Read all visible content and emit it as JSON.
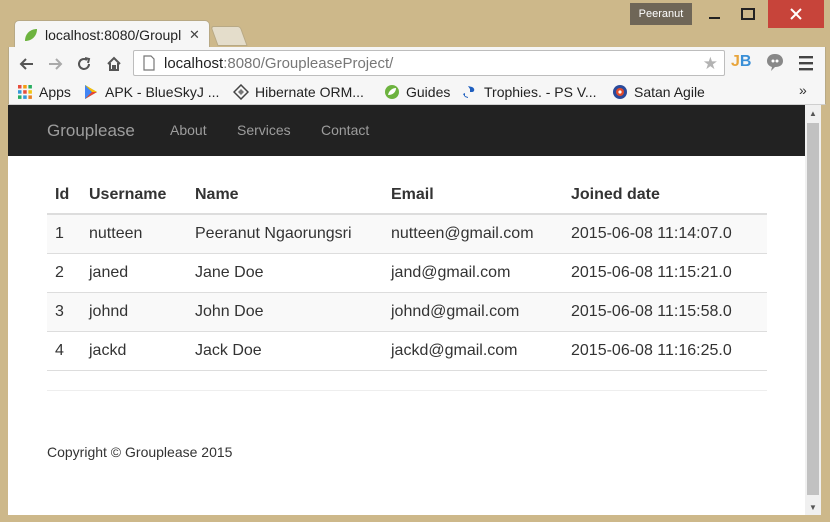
{
  "window": {
    "user_badge": "Peeranut"
  },
  "tab": {
    "title": "localhost:8080/Groupl"
  },
  "toolbar": {
    "url_host": "localhost",
    "url_rest": ":8080/GroupleaseProject/",
    "extension_label": "JB"
  },
  "bookmarks": [
    {
      "label": "Apps",
      "icon": "apps-grid-icon"
    },
    {
      "label": "APK - BlueSkyJ ...",
      "icon": "play-store-icon"
    },
    {
      "label": "Hibernate ORM...",
      "icon": "hibernate-icon"
    },
    {
      "label": "Guides",
      "icon": "spring-icon"
    },
    {
      "label": "Trophies. - PS V...",
      "icon": "playstation-icon"
    },
    {
      "label": "Satan Agile",
      "icon": "satan-agile-icon"
    }
  ],
  "bookmarks_more": "»",
  "navbar": {
    "brand": "Grouplease",
    "links": [
      "About",
      "Services",
      "Contact"
    ]
  },
  "table": {
    "headers": [
      "Id",
      "Username",
      "Name",
      "Email",
      "Joined date"
    ],
    "rows": [
      [
        "1",
        "nutteen",
        "Peeranut Ngaorungsri",
        "nutteen@gmail.com",
        "2015-06-08 11:14:07.0"
      ],
      [
        "2",
        "janed",
        "Jane Doe",
        "jand@gmail.com",
        "2015-06-08 11:15:21.0"
      ],
      [
        "3",
        "johnd",
        "John Doe",
        "johnd@gmail.com",
        "2015-06-08 11:15:58.0"
      ],
      [
        "4",
        "jackd",
        "Jack Doe",
        "jackd@gmail.com",
        "2015-06-08 11:16:25.0"
      ]
    ]
  },
  "footer": {
    "text": "Copyright © Grouplease 2015"
  }
}
